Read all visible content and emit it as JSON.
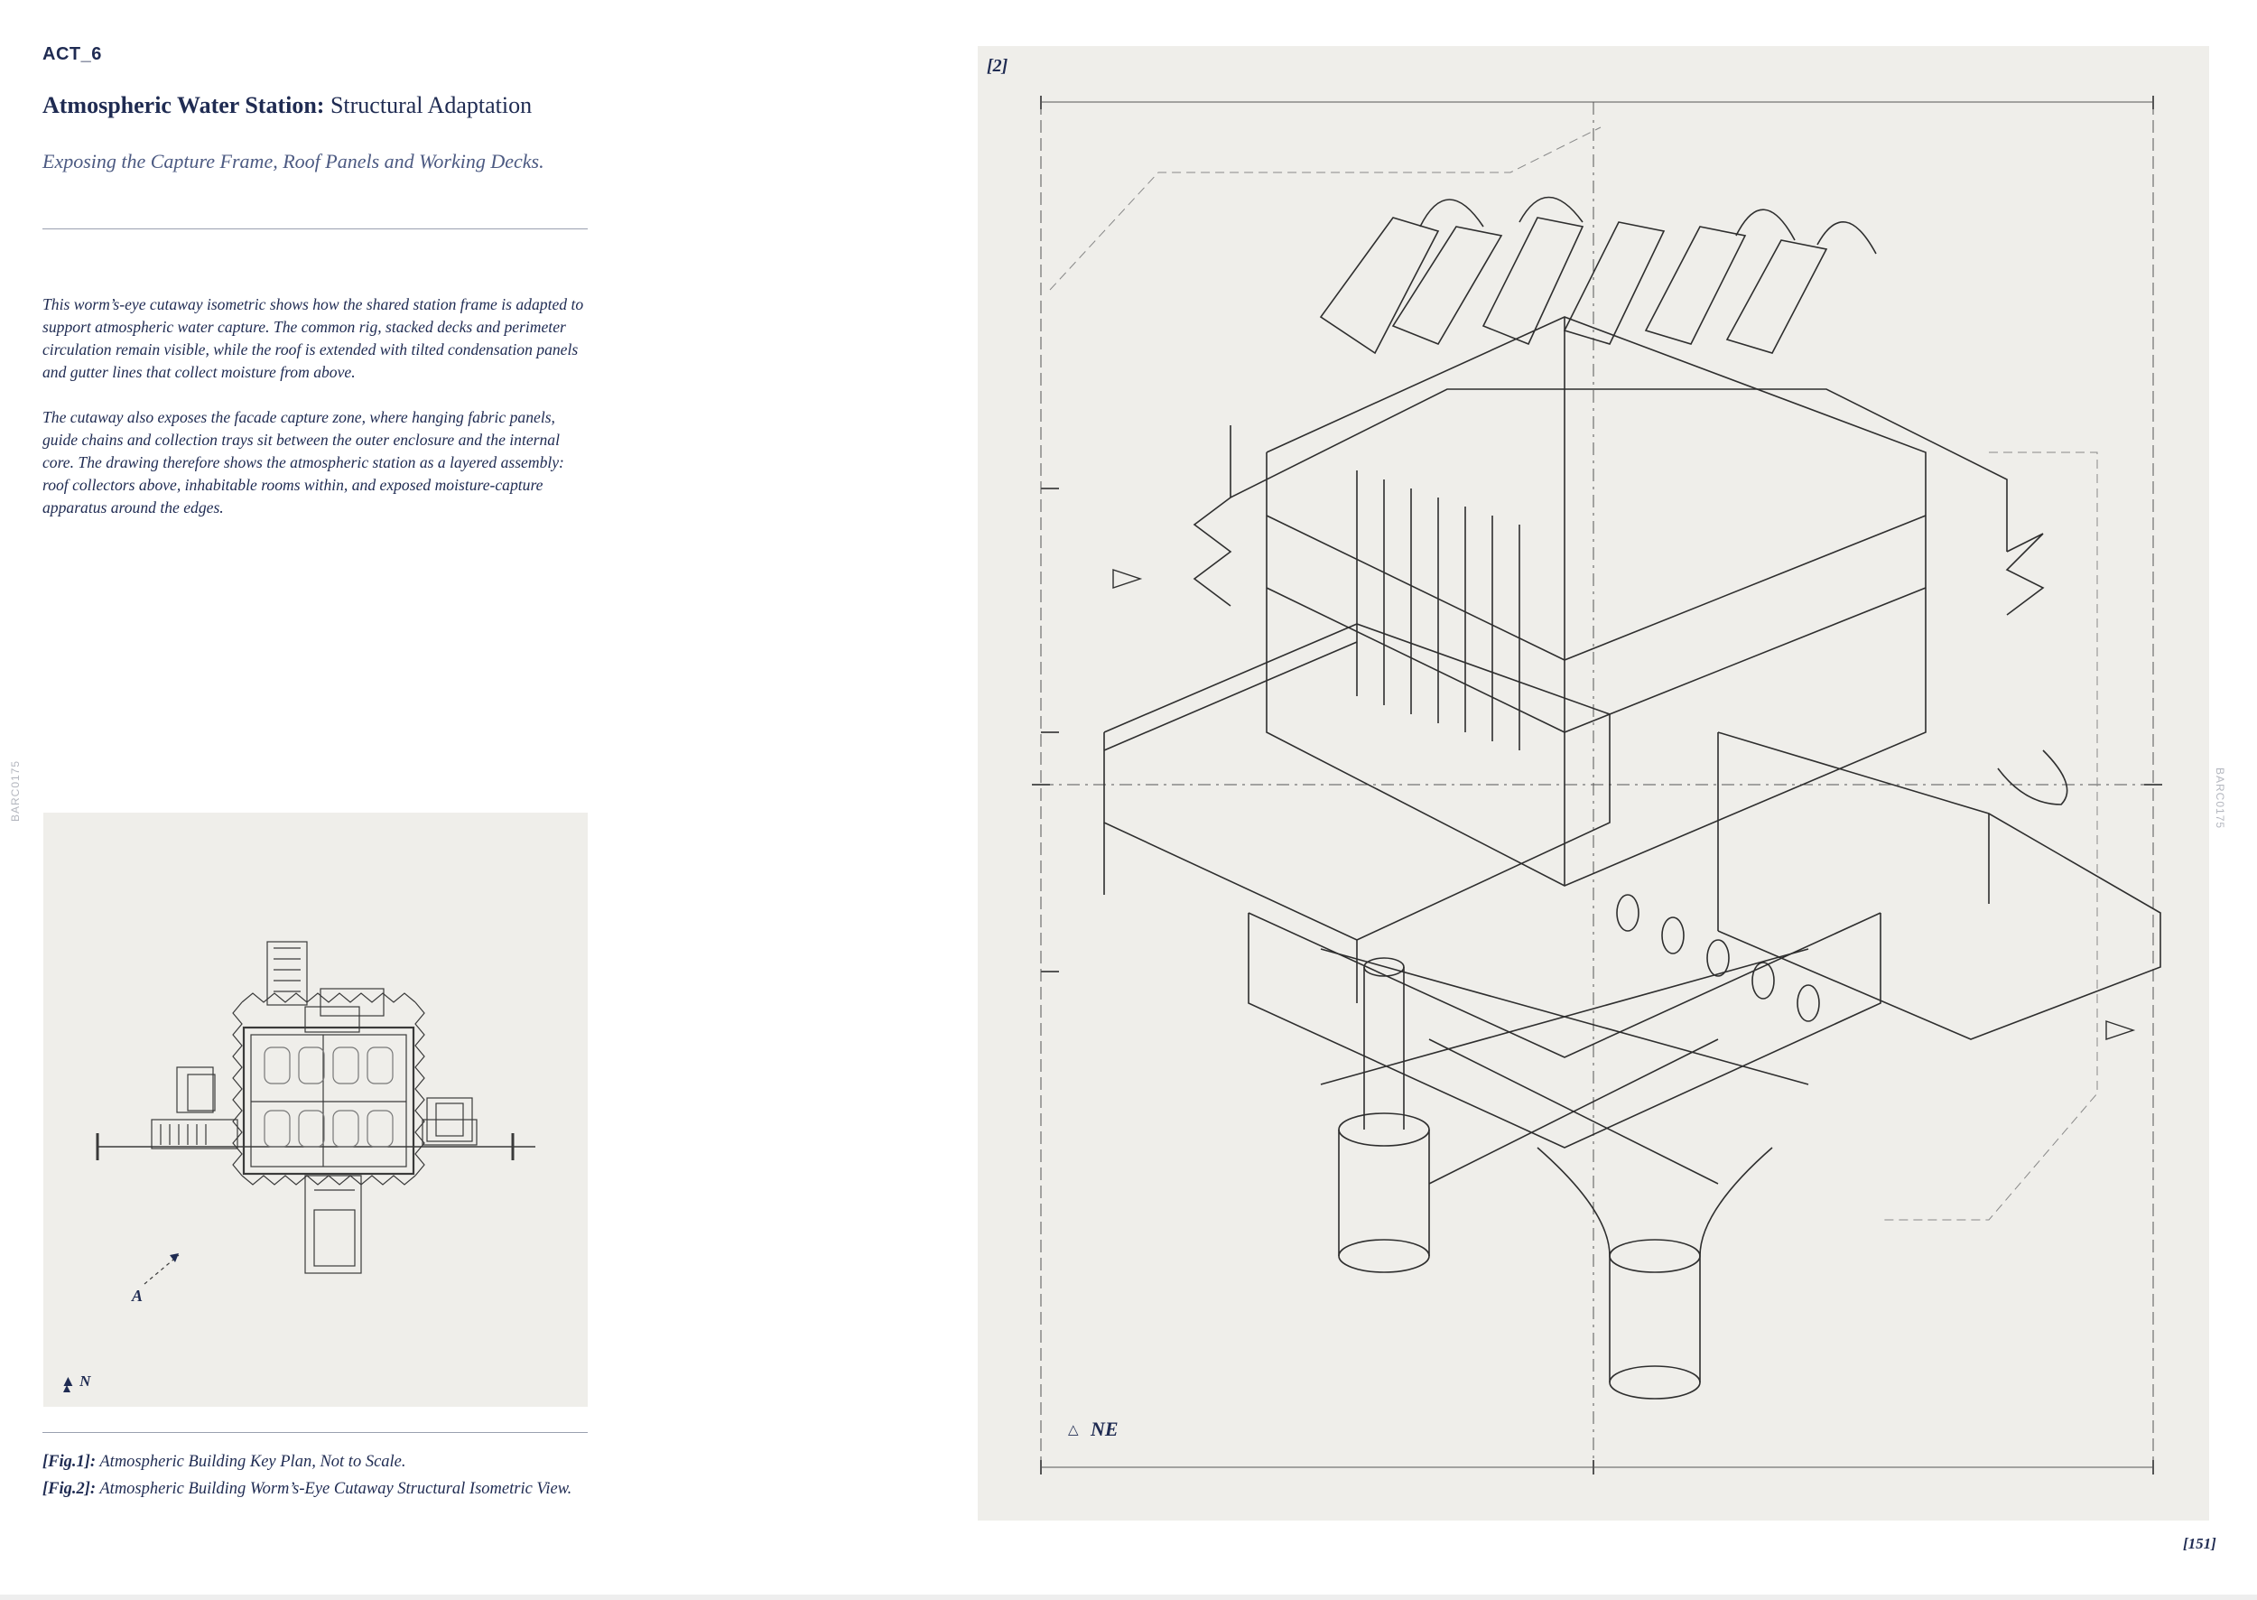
{
  "header": {
    "act_tag": "ACT_6",
    "title_bold": "Atmospheric Water Station:",
    "title_regular": " Structural Adaptation",
    "subtitle": "Exposing the Capture Frame, Roof Panels and Working Decks."
  },
  "body": {
    "paragraph_1": "This worm’s-eye cutaway isometric shows how the shared station frame is adapted to support atmospheric water capture. The common rig, stacked decks and perimeter circulation remain visible, while the roof is extended with tilted condensation panels and gutter lines that collect moisture from above.",
    "paragraph_2": "The cutaway also exposes the facade capture zone, where hanging fabric panels, guide chains and collection trays sit between the outer enclosure and the internal core. The drawing therefore shows the atmospheric station as a layered assembly: roof collectors above, inhabitable rooms within, and exposed moisture-capture apparatus around the edges."
  },
  "side_label": "BARC0175",
  "key_plan": {
    "section_label": "A",
    "north_label": "N",
    "north_icon": "triangle-up"
  },
  "captions": [
    {
      "ref": "[Fig.1]:",
      "text": " Atmospheric Building Key Plan, Not to Scale."
    },
    {
      "ref": "[Fig.2]:",
      "text": " Atmospheric Building Worm’s-Eye Cutaway Structural Isometric View."
    }
  ],
  "isometric": {
    "figure_ref": "[2]",
    "orientation_label": "NE",
    "orientation_icon": "triangle-outline"
  },
  "page_number": "[151]",
  "colors": {
    "ink": "#1f2b52",
    "subtitle": "#4c5a82",
    "panel": "#efeeea",
    "linework": "#3a3a3a"
  }
}
